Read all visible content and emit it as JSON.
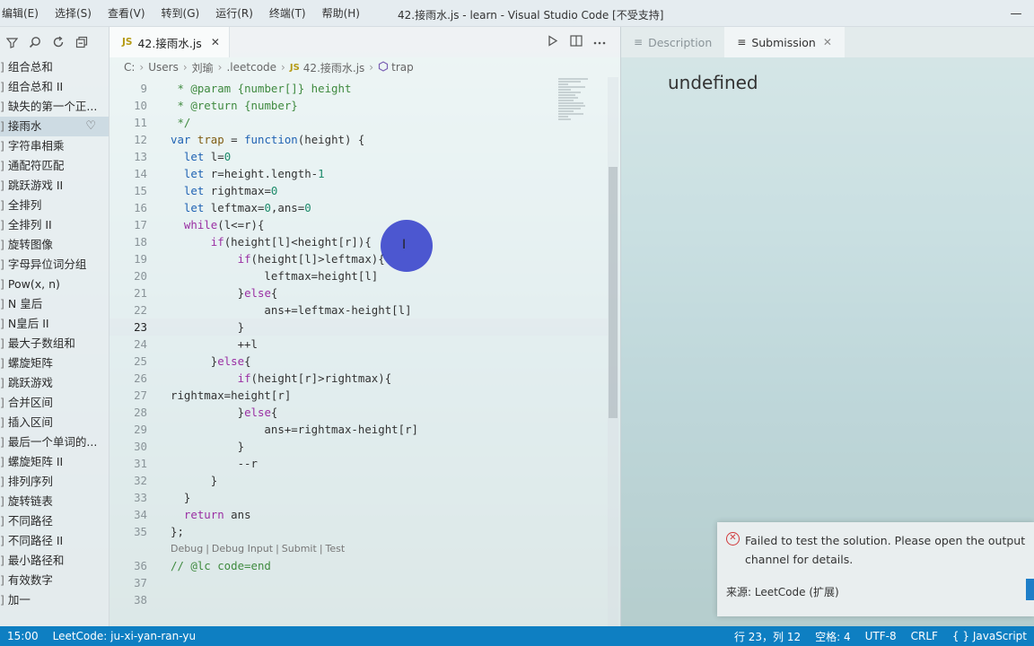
{
  "menu": [
    "编辑(E)",
    "选择(S)",
    "查看(V)",
    "转到(G)",
    "运行(R)",
    "终端(T)",
    "帮助(H)"
  ],
  "window_title": "42.接雨水.js - learn - Visual Studio Code [不受支持]",
  "window_controls": [
    "—",
    "❐",
    "✕"
  ],
  "sidebar": {
    "tools": [
      "filter-icon",
      "search-icon",
      "refresh-icon",
      "collapse-icon"
    ],
    "items": [
      {
        "label": "组合总和",
        "active": false
      },
      {
        "label": "组合总和 II",
        "active": false
      },
      {
        "label": "缺失的第一个正...",
        "active": false
      },
      {
        "label": "接雨水",
        "active": true
      },
      {
        "label": "字符串相乘",
        "active": false
      },
      {
        "label": "通配符匹配",
        "active": false
      },
      {
        "label": "跳跃游戏 II",
        "active": false
      },
      {
        "label": "全排列",
        "active": false
      },
      {
        "label": "全排列 II",
        "active": false
      },
      {
        "label": "旋转图像",
        "active": false
      },
      {
        "label": "字母异位词分组",
        "active": false
      },
      {
        "label": "Pow(x, n)",
        "active": false
      },
      {
        "label": "N 皇后",
        "active": false
      },
      {
        "label": "N皇后 II",
        "active": false
      },
      {
        "label": "最大子数组和",
        "active": false
      },
      {
        "label": "螺旋矩阵",
        "active": false
      },
      {
        "label": "跳跃游戏",
        "active": false
      },
      {
        "label": "合并区间",
        "active": false
      },
      {
        "label": "插入区间",
        "active": false
      },
      {
        "label": "最后一个单词的...",
        "active": false
      },
      {
        "label": "螺旋矩阵 II",
        "active": false
      },
      {
        "label": "排列序列",
        "active": false
      },
      {
        "label": "旋转链表",
        "active": false
      },
      {
        "label": "不同路径",
        "active": false
      },
      {
        "label": "不同路径 II",
        "active": false
      },
      {
        "label": "最小路径和",
        "active": false
      },
      {
        "label": "有效数字",
        "active": false
      },
      {
        "label": "加一",
        "active": false
      }
    ]
  },
  "editor": {
    "tab": {
      "badge": "JS",
      "label": "42.接雨水.js",
      "close": "✕"
    },
    "breadcrumb": [
      "C:",
      "Users",
      "刘瑜",
      ".leetcode",
      "42.接雨水.js",
      "trap"
    ],
    "current_line": 23,
    "lines": [
      {
        "n": "9",
        "html": " <span class='cm'>* @param {number[]} height</span>"
      },
      {
        "n": "10",
        "html": " <span class='cm'>* @return {number}</span>"
      },
      {
        "n": "11",
        "html": " <span class='cm'>*/</span>"
      },
      {
        "n": "12",
        "html": "<span class='kw2'>var</span> <span class='fn'>trap</span> = <span class='kw2'>function</span>(height) {"
      },
      {
        "n": "13",
        "html": "  <span class='kw2'>let</span> l=<span class='num'>0</span>"
      },
      {
        "n": "14",
        "html": "  <span class='kw2'>let</span> r=height.length-<span class='num'>1</span>"
      },
      {
        "n": "15",
        "html": "  <span class='kw2'>let</span> rightmax=<span class='num'>0</span>"
      },
      {
        "n": "16",
        "html": "  <span class='kw2'>let</span> leftmax=<span class='num'>0</span>,ans=<span class='num'>0</span>"
      },
      {
        "n": "17",
        "html": "  <span class='kw'>while</span>(l&lt;=r){"
      },
      {
        "n": "18",
        "html": "      <span class='kw'>if</span>(height[l]&lt;height[r]){"
      },
      {
        "n": "19",
        "html": "          <span class='kw'>if</span>(height[l]&gt;leftmax){"
      },
      {
        "n": "20",
        "html": "              leftmax=height[l]"
      },
      {
        "n": "21",
        "html": "          }<span class='kw'>else</span>{"
      },
      {
        "n": "22",
        "html": "              ans+=leftmax-height[l]"
      },
      {
        "n": "23",
        "html": "          }"
      },
      {
        "n": "24",
        "html": "          ++l"
      },
      {
        "n": "25",
        "html": "      }<span class='kw'>else</span>{"
      },
      {
        "n": "26",
        "html": "          <span class='kw'>if</span>(height[r]&gt;rightmax){"
      },
      {
        "n": "27",
        "html": "rightmax=height[r]"
      },
      {
        "n": "28",
        "html": "          }<span class='kw'>else</span>{"
      },
      {
        "n": "29",
        "html": "              ans+=rightmax-height[r]"
      },
      {
        "n": "30",
        "html": "          }"
      },
      {
        "n": "31",
        "html": "          --r"
      },
      {
        "n": "32",
        "html": "      }"
      },
      {
        "n": "33",
        "html": "  }"
      },
      {
        "n": "34",
        "html": "  <span class='kw'>return</span> ans"
      },
      {
        "n": "35",
        "html": "};"
      },
      {
        "lens": [
          "Debug",
          "Debug Input",
          "Submit",
          "Test"
        ]
      },
      {
        "n": "36",
        "html": "<span class='cm'>// @lc code=end</span>"
      },
      {
        "n": "37",
        "html": ""
      },
      {
        "n": "38",
        "html": ""
      }
    ]
  },
  "right_panel": {
    "tabs": [
      {
        "label": "Description",
        "icon": "preview-icon",
        "active": false
      },
      {
        "label": "Submission",
        "icon": "preview-icon",
        "active": true
      }
    ],
    "content": "undefined",
    "notification": {
      "message": "Failed to test the solution. Please open the output channel for details.",
      "source": "来源: LeetCode (扩展)"
    }
  },
  "statusbar": {
    "time": "15:00",
    "account": "LeetCode: ju-xi-yan-ran-yu",
    "position": "行 23，列 12",
    "spaces": "空格: 4",
    "encoding": "UTF-8",
    "eol": "CRLF",
    "language": "JavaScript",
    "accent": "#0e7fc2"
  }
}
